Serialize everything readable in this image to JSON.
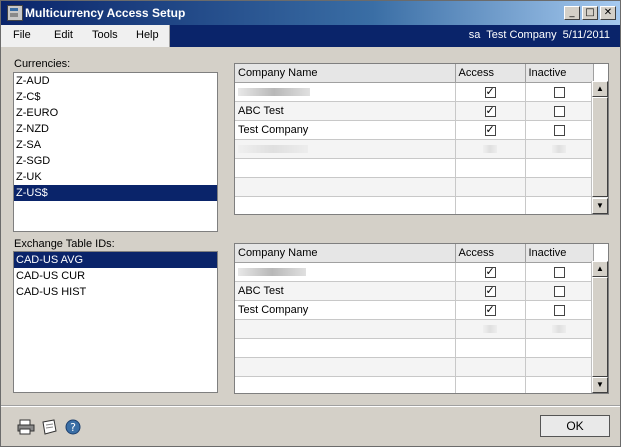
{
  "window": {
    "title": "Multicurrency Access Setup"
  },
  "titlebar": {
    "min_glyph": "_",
    "max_glyph": "□",
    "close_glyph": "✕"
  },
  "menu": {
    "items": [
      "File",
      "Edit",
      "Tools",
      "Help"
    ],
    "status": "sa  Test Company  5/11/2011"
  },
  "currencies": {
    "label": "Currencies:",
    "items": [
      "Z-AUD",
      "Z-C$",
      "Z-EURO",
      "Z-NZD",
      "Z-SA",
      "Z-SGD",
      "Z-UK",
      "Z-US$"
    ],
    "selected": "Z-US$"
  },
  "exchange": {
    "label": "Exchange Table IDs:",
    "items": [
      "CAD-US AVG",
      "CAD-US CUR",
      "CAD-US HIST"
    ],
    "selected": "CAD-US AVG"
  },
  "grid_top": {
    "headers": [
      "Company Name",
      "Access",
      "Inactive"
    ],
    "rows": [
      {
        "name": "",
        "blurred": true,
        "access": true,
        "inactive": false
      },
      {
        "name": "ABC Test",
        "access": true,
        "inactive": false
      },
      {
        "name": "Test Company",
        "access": true,
        "inactive": false
      }
    ]
  },
  "grid_bottom": {
    "headers": [
      "Company Name",
      "Access",
      "Inactive"
    ],
    "rows": [
      {
        "name": "",
        "blurred": true,
        "access": true,
        "inactive": false
      },
      {
        "name": "ABC Test",
        "access": true,
        "inactive": false
      },
      {
        "name": "Test Company",
        "access": true,
        "inactive": false
      }
    ]
  },
  "footer": {
    "ok_label": "OK",
    "icons": [
      "printer-icon",
      "note-icon",
      "help-icon"
    ]
  },
  "colors": {
    "title_start": "#0a246a",
    "selection": "#0a246a",
    "face": "#d4d0c8"
  }
}
